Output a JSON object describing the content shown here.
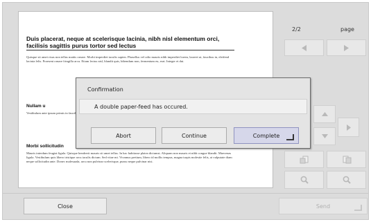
{
  "preview": {
    "title": "Duis placerat, neque at scelerisque lacinia, nibh nisl elementum orci, facilisis sagittis purus tortor sed lectus",
    "para1": "Quisque sit amet risus non tellus mattis ornare. Morbi imperdiet iaculis sapien. Phasellus vel odio mauris nibh imperdiet lorem, laoreet ut, faucibus in, eleifend lacinia felis. Praesent ornare fringilla arcu. Etiam lectus nisl, blandit quis, bibendum non, fermentum eu, erat. Integer et dui.",
    "heading2": "Nullam u",
    "para2": "Vestibulum ante ipsum primis in faucibus orci luctus et ultrices posuere cubilia Curae; Sed vitae hymenaeos. Nam facilisis orci, et eleifend tristique urna.",
    "heading3": "Morbi sollicitudin",
    "para3": "Mauris interdum feugiat ligula. Quisque hendrerit mauris sit amet tellus. In hac habitasse platea dictumst. Aliquam non mauris et nibh congue blandit. Maecenas ligula. Vestibulum quis libero tristique arcu iaculis dictum. Sed vitae mi. Vivamus pretium, libero id mollis tempus, magna turpis molestie felis, at vulputate diam neque sollicitudin ante. Donec malesuada, arcu non pulvinar scelerisque, purus neque pulvinar nisi."
  },
  "pager": {
    "counter": "2/2",
    "label": "page"
  },
  "dialog": {
    "title": "Confirmation",
    "message": "A double paper-feed has occured.",
    "buttons": {
      "abort": "Abort",
      "continue": "Continue",
      "complete": "Complete"
    }
  },
  "footer": {
    "close": "Close",
    "send": "Send"
  },
  "colors": {
    "frame": "#dcdcdc",
    "primary_button": "#d6d7ea",
    "disabled_text": "#b0b0b0"
  }
}
